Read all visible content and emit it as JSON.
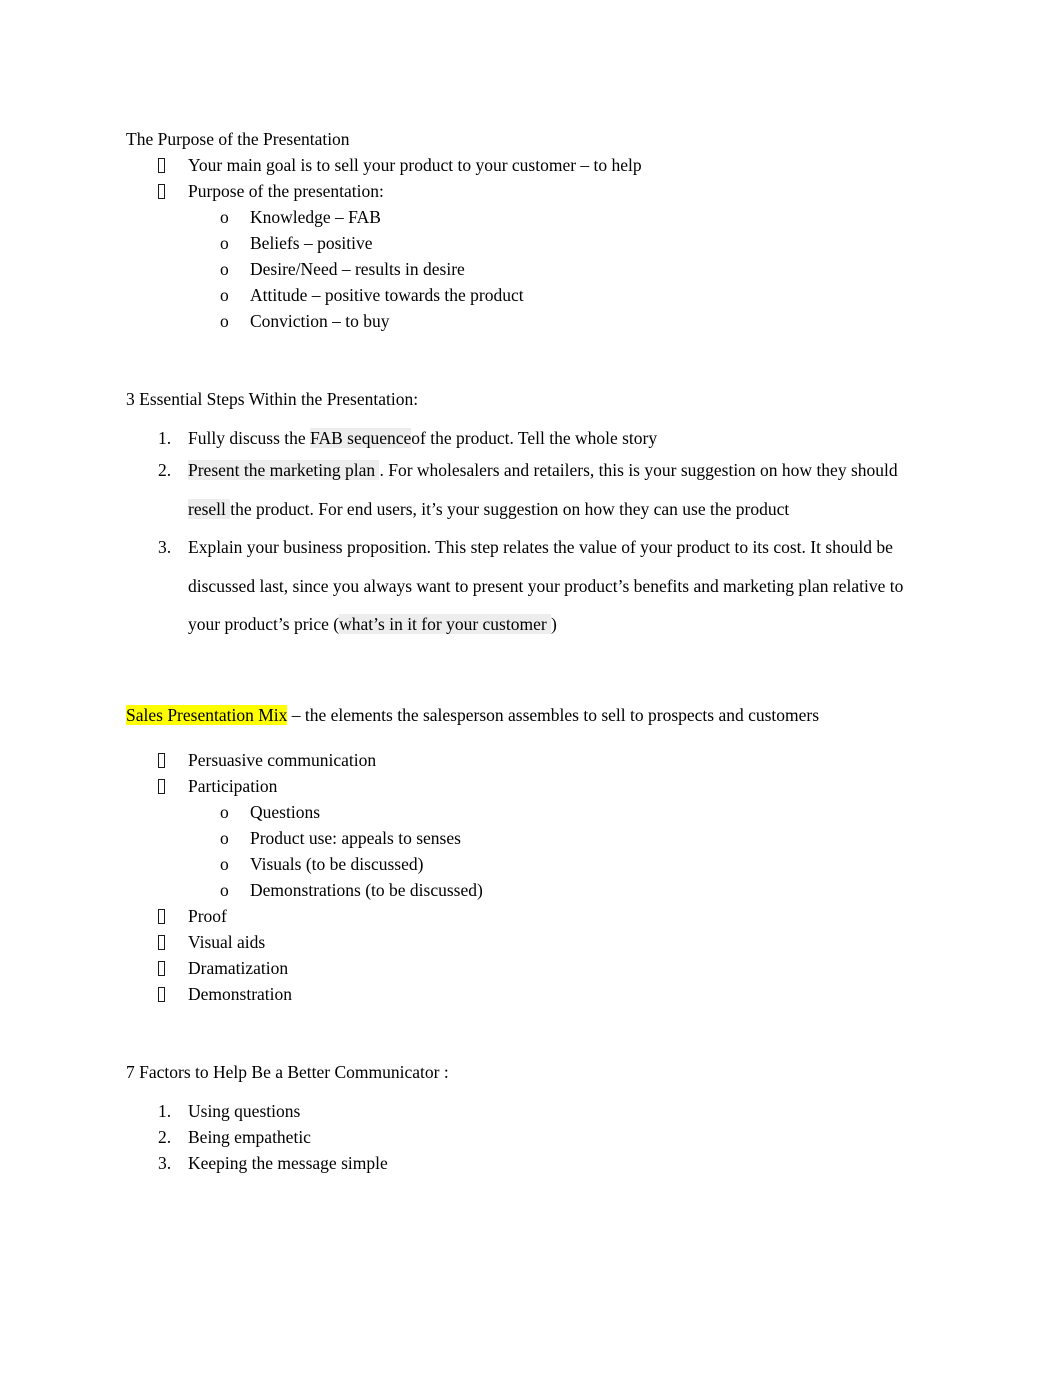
{
  "document": {
    "background": "#ffffff",
    "text_color": "#000000",
    "highlight_color": "#ffff00",
    "field_shading_color": "#ededed",
    "bullet_glyph": "missing-glyph-box",
    "sublevel_bullet_glyph": "o"
  },
  "sections": [
    {
      "heading": "The Purpose of the Presentation",
      "items": [
        {
          "marker": "bullet",
          "text": "Your main goal is to sell your product to your customer – to help"
        },
        {
          "marker": "bullet",
          "text": "Purpose of the presentation:"
        },
        {
          "marker": "o",
          "text": "Knowledge – FAB"
        },
        {
          "marker": "o",
          "text": "Beliefs – positive"
        },
        {
          "marker": "o",
          "text": "Desire/Need – results in desire"
        },
        {
          "marker": "o",
          "text": "Attitude – positive towards the product"
        },
        {
          "marker": "o",
          "text": "Conviction – to buy"
        }
      ]
    },
    {
      "heading": "3 Essential Steps Within the Presentation:",
      "steps": [
        {
          "number": "1.",
          "runs": [
            {
              "text": "Fully discuss the "
            },
            {
              "text": "FAB sequence",
              "shaded": true
            },
            {
              "text": "of the product. Tell the whole story"
            }
          ]
        },
        {
          "number": "2.",
          "runs": [
            {
              "text": "Present the marketing plan ",
              "shaded": true
            },
            {
              "text": ". For wholesalers and retailers, this is your suggestion on how they should "
            },
            {
              "text": "resell ",
              "shaded": true
            },
            {
              "text": "the product. For end users, it’s your suggestion on how they can use",
              "trailing_shaded": true
            },
            {
              "text": " the product"
            }
          ]
        },
        {
          "number": "3.",
          "runs": [
            {
              "text": "Explain your business proposition. This step relates the value of your product to its cost. It should be discussed last, since you always want to present your product’s benefits and marketing plan relative to your product’s price ("
            },
            {
              "text": "what’s in it for your customer ",
              "shaded": true
            },
            {
              "text": ")"
            }
          ]
        }
      ]
    },
    {
      "definition": {
        "term": "Sales Presentation Mix",
        "term_highlighted": true,
        "body": " – the elements the salesperson assembles to sell to prospects and customers"
      },
      "items": [
        {
          "marker": "bullet",
          "text": "Persuasive communication"
        },
        {
          "marker": "bullet",
          "text": "Participation"
        },
        {
          "marker": "o",
          "text": "Questions"
        },
        {
          "marker": "o",
          "text": "Product use: appeals to senses"
        },
        {
          "marker": "o",
          "text": "Visuals (to be discussed)"
        },
        {
          "marker": "o",
          "text": "Demonstrations (to be discussed)"
        },
        {
          "marker": "bullet",
          "text": "Proof"
        },
        {
          "marker": "bullet",
          "text": "Visual aids"
        },
        {
          "marker": "bullet",
          "text": "Dramatization"
        },
        {
          "marker": "bullet",
          "text": "Demonstration"
        }
      ]
    },
    {
      "heading": "7 Factors to Help Be a Better Communicator :",
      "steps": [
        {
          "number": "1.",
          "text": "Using questions"
        },
        {
          "number": "2.",
          "text": "Being empathetic"
        },
        {
          "number": "3.",
          "text": "Keeping the message simple"
        }
      ]
    }
  ]
}
